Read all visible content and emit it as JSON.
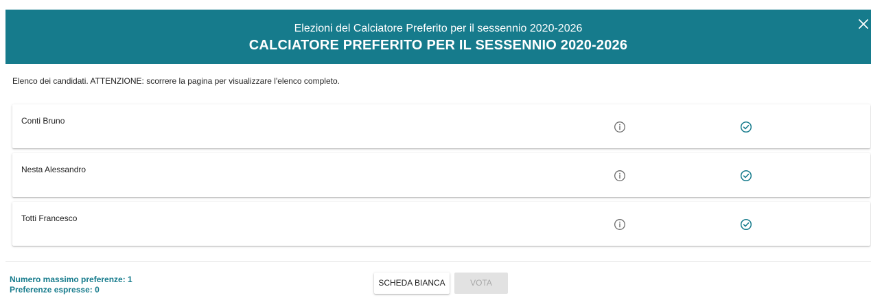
{
  "header": {
    "subtitle": "Elezioni del Calciatore Preferito per il sessennio 2020-2026",
    "title": "CALCIATORE PREFERITO PER IL SESSENNIO 2020-2026",
    "close_icon": "close-icon"
  },
  "instructions": "Elenco dei candidati. ATTENZIONE: scorrere la pagina per visualizzare l'elenco completo.",
  "candidates": [
    {
      "name": "Conti Bruno"
    },
    {
      "name": "Nesta Alessandro"
    },
    {
      "name": "Totti Francesco"
    }
  ],
  "footer": {
    "max_preferences": "Numero massimo preferenze: 1",
    "expressed_preferences": "Preferenze espresse: 0",
    "blank_ballot_label": "SCHEDA BIANCA",
    "vote_label": "VOTA"
  },
  "icons": {
    "info": "info-icon",
    "select": "check-circle-icon"
  },
  "colors": {
    "brand": "#167b8c",
    "disabled_bg": "#e2e2e2",
    "disabled_text": "#a8a8a8"
  }
}
